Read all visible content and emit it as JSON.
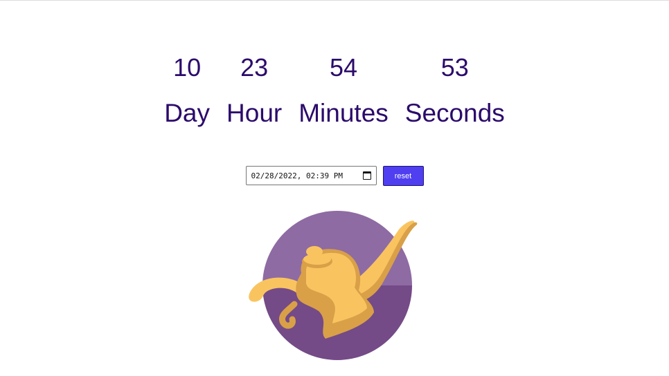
{
  "countdown": {
    "units": [
      {
        "value": "10",
        "label": "Day"
      },
      {
        "value": "23",
        "label": "Hour"
      },
      {
        "value": "54",
        "label": "Minutes"
      },
      {
        "value": "53",
        "label": "Seconds"
      }
    ]
  },
  "controls": {
    "datetime_value": "02/28/2022, 02:39 PM",
    "reset_label": "reset"
  },
  "illustration": {
    "icon": "genie-lamp-icon",
    "colors": {
      "circle_top": "#8e6ba3",
      "circle_bottom": "#744a87",
      "lamp_light": "#f9c460",
      "lamp_dark": "#d9a048"
    }
  },
  "theme": {
    "text_color": "#2b0a6b",
    "button_color": "#4f3ff0"
  }
}
